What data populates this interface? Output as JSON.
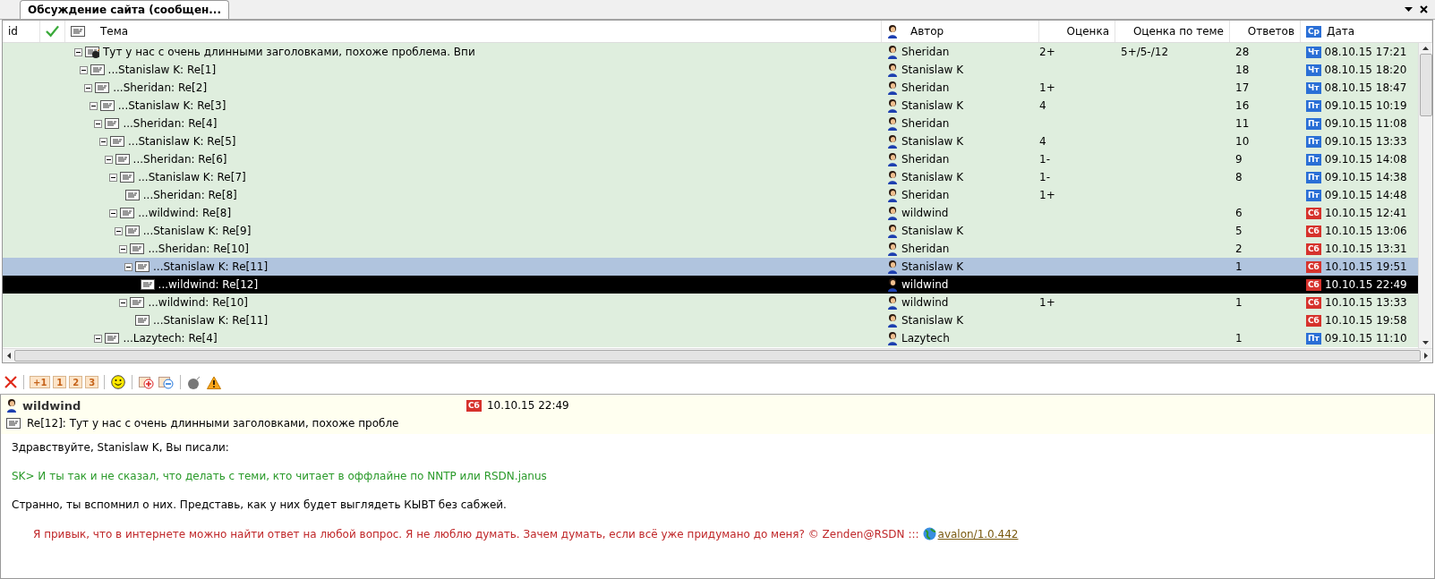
{
  "tab": {
    "title": "Обсуждение сайта (сообщен..."
  },
  "table": {
    "columns": [
      {
        "kind": "id",
        "label": "id"
      },
      {
        "kind": "check"
      },
      {
        "kind": "topic",
        "label": "Тема"
      },
      {
        "kind": "author",
        "label": "Автор"
      },
      {
        "kind": "rating",
        "label": "Оценка"
      },
      {
        "kind": "topic_rating",
        "label": "Оценка по теме"
      },
      {
        "kind": "replies",
        "label": "Ответов"
      },
      {
        "kind": "date",
        "label": "Дата",
        "day": "Ср",
        "color": "#2a6fd6"
      }
    ],
    "rows": [
      {
        "topic": "Тут у нас с очень длинными заголовками, похоже проблема. Впи",
        "kind": "root",
        "author": "Sheridan",
        "rating": "2+",
        "topic_rating": "5+/5-/12",
        "replies": "28",
        "day": "Чт",
        "color": "#2a6fd6",
        "date": "08.10.15 17:21",
        "expanded": true,
        "selected": false,
        "highlighted": false,
        "children": [
          {
            "topic": "...Stanislaw K: Re[1]",
            "author": "Stanislaw K",
            "replies": "18",
            "day": "Чт",
            "color": "#2a6fd6",
            "date": "08.10.15 18:20",
            "expanded": true,
            "selected": false,
            "highlighted": false,
            "children": [
              {
                "topic": "...Sheridan: Re[2]",
                "author": "Sheridan",
                "rating": "1+",
                "replies": "17",
                "day": "Чт",
                "color": "#2a6fd6",
                "date": "08.10.15 18:47",
                "expanded": true,
                "selected": false,
                "highlighted": false,
                "children": [
                  {
                    "topic": "...Stanislaw K: Re[3]",
                    "author": "Stanislaw K",
                    "rating": "4",
                    "replies": "16",
                    "day": "Пт",
                    "color": "#2a6fd6",
                    "date": "09.10.15 10:19",
                    "expanded": true,
                    "selected": false,
                    "highlighted": false,
                    "children": [
                      {
                        "topic": "...Sheridan: Re[4]",
                        "author": "Sheridan",
                        "replies": "11",
                        "day": "Пт",
                        "color": "#2a6fd6",
                        "date": "09.10.15 11:08",
                        "expanded": true,
                        "selected": false,
                        "highlighted": false,
                        "children": [
                          {
                            "topic": "...Stanislaw K: Re[5]",
                            "author": "Stanislaw K",
                            "rating": "4",
                            "replies": "10",
                            "day": "Пт",
                            "color": "#2a6fd6",
                            "date": "09.10.15 13:33",
                            "expanded": true,
                            "selected": false,
                            "highlighted": false,
                            "children": [
                              {
                                "topic": "...Sheridan: Re[6]",
                                "author": "Sheridan",
                                "rating": "1-",
                                "replies": "9",
                                "day": "Пт",
                                "color": "#2a6fd6",
                                "date": "09.10.15 14:08",
                                "expanded": true,
                                "selected": false,
                                "highlighted": false,
                                "children": [
                                  {
                                    "topic": "...Stanislaw K: Re[7]",
                                    "author": "Stanislaw K",
                                    "rating": "1-",
                                    "replies": "8",
                                    "day": "Пт",
                                    "color": "#2a6fd6",
                                    "date": "09.10.15 14:38",
                                    "expanded": true,
                                    "selected": false,
                                    "highlighted": false,
                                    "children": [
                                      {
                                        "topic": "...Sheridan: Re[8]",
                                        "author": "Sheridan",
                                        "rating": "1+",
                                        "day": "Пт",
                                        "color": "#2a6fd6",
                                        "date": "09.10.15 14:48",
                                        "expanded": false,
                                        "selected": false,
                                        "highlighted": false
                                      }
                                    ]
                                  },
                                  {
                                    "topic": "...wildwind: Re[8]",
                                    "author": "wildwind",
                                    "replies": "6",
                                    "day": "Сб",
                                    "color": "#d6322c",
                                    "date": "10.10.15 12:41",
                                    "expanded": true,
                                    "selected": false,
                                    "highlighted": false,
                                    "children": [
                                      {
                                        "topic": "...Stanislaw K: Re[9]",
                                        "author": "Stanislaw K",
                                        "replies": "5",
                                        "day": "Сб",
                                        "color": "#d6322c",
                                        "date": "10.10.15 13:06",
                                        "expanded": true,
                                        "selected": false,
                                        "highlighted": false,
                                        "children": [
                                          {
                                            "topic": "...Sheridan: Re[10]",
                                            "author": "Sheridan",
                                            "replies": "2",
                                            "day": "Сб",
                                            "color": "#d6322c",
                                            "date": "10.10.15 13:31",
                                            "expanded": true,
                                            "selected": false,
                                            "highlighted": false,
                                            "children": [
                                              {
                                                "topic": "...Stanislaw K: Re[11]",
                                                "author": "Stanislaw K",
                                                "replies": "1",
                                                "day": "Сб",
                                                "color": "#d6322c",
                                                "date": "10.10.15 19:51",
                                                "expanded": true,
                                                "selected": false,
                                                "highlighted": true,
                                                "children": [
                                                  {
                                                    "topic": "...wildwind: Re[12]",
                                                    "author": "wildwind",
                                                    "day": "Сб",
                                                    "color": "#d6322c",
                                                    "date": "10.10.15 22:49",
                                                    "expanded": false,
                                                    "selected": true,
                                                    "highlighted": false
                                                  }
                                                ]
                                              }
                                            ]
                                          },
                                          {
                                            "topic": "...wildwind: Re[10]",
                                            "author": "wildwind",
                                            "rating": "1+",
                                            "replies": "1",
                                            "day": "Сб",
                                            "color": "#d6322c",
                                            "date": "10.10.15 13:33",
                                            "expanded": true,
                                            "selected": false,
                                            "highlighted": false,
                                            "children": [
                                              {
                                                "topic": "...Stanislaw K: Re[11]",
                                                "author": "Stanislaw K",
                                                "day": "Сб",
                                                "color": "#d6322c",
                                                "date": "10.10.15 19:58",
                                                "expanded": false,
                                                "selected": false,
                                                "highlighted": false
                                              }
                                            ]
                                          }
                                        ]
                                      }
                                    ]
                                  }
                                ]
                              }
                            ]
                          }
                        ]
                      },
                      {
                        "topic": "...Lazytech: Re[4]",
                        "author": "Lazytech",
                        "replies": "1",
                        "day": "Пт",
                        "color": "#2a6fd6",
                        "date": "09.10.15 11:10",
                        "expanded": true,
                        "selected": false,
                        "highlighted": false
                      }
                    ]
                  }
                ]
              }
            ]
          }
        ]
      }
    ]
  },
  "toolbar": [
    {
      "kind": "delete"
    },
    {
      "kind": "rate",
      "label": "+1"
    },
    {
      "kind": "rate",
      "label": "1"
    },
    {
      "kind": "rate",
      "label": "2"
    },
    {
      "kind": "rate",
      "label": "3"
    },
    {
      "kind": "smile"
    },
    {
      "kind": "plus"
    },
    {
      "kind": "minus"
    },
    {
      "kind": "bomb"
    },
    {
      "kind": "warning"
    }
  ],
  "message": {
    "author": "wildwind",
    "day": "Сб",
    "color": "#d6322c",
    "date": "10.10.15 22:49",
    "subject": "Re[12]: Тут у нас с очень длинными заголовками, похоже пробле",
    "body": [
      {
        "kind": "text",
        "text": "Здравствуйте, Stanislaw K, Вы писали:"
      },
      {
        "kind": "quote",
        "text": "SK> И ты так и не сказал, что делать с теми, кто читает в оффлайне по NNTP или RSDN.janus"
      },
      {
        "kind": "text",
        "text": "Странно, ты вспомнил о них. Представь, как у них будет выглядеть КЫВТ без сабжей."
      },
      {
        "kind": "signature",
        "text": "Я привык, что в интернете можно найти ответ на любой вопрос. Я не люблю думать. Зачем думать, если всё уже придумано до меня? © Zenden@RSDN :::",
        "link": "avalon/1.0.442"
      }
    ]
  }
}
